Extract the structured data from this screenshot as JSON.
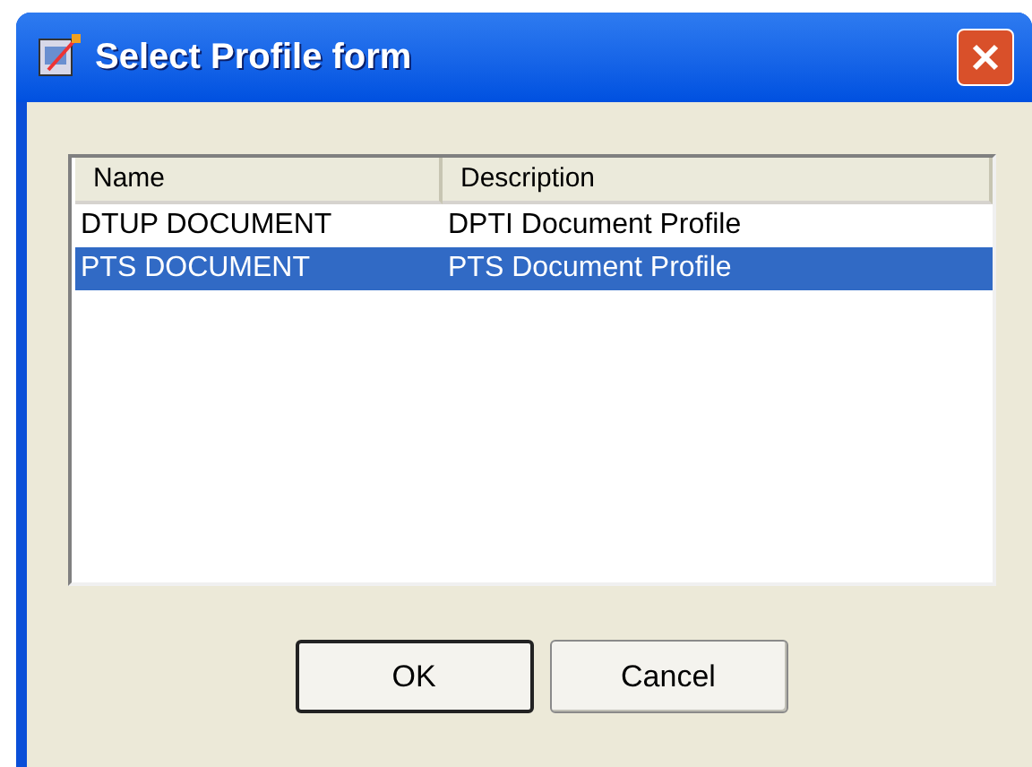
{
  "window": {
    "title": "Select Profile form"
  },
  "table": {
    "columns": [
      "Name",
      "Description"
    ],
    "rows": [
      {
        "cells": [
          "DTUP DOCUMENT",
          "DPTI Document Profile"
        ],
        "selected": false
      },
      {
        "cells": [
          "PTS DOCUMENT",
          "PTS Document Profile"
        ],
        "selected": true
      }
    ]
  },
  "buttons": [
    {
      "label": "OK",
      "default": true
    },
    {
      "label": "Cancel",
      "default": false
    }
  ]
}
